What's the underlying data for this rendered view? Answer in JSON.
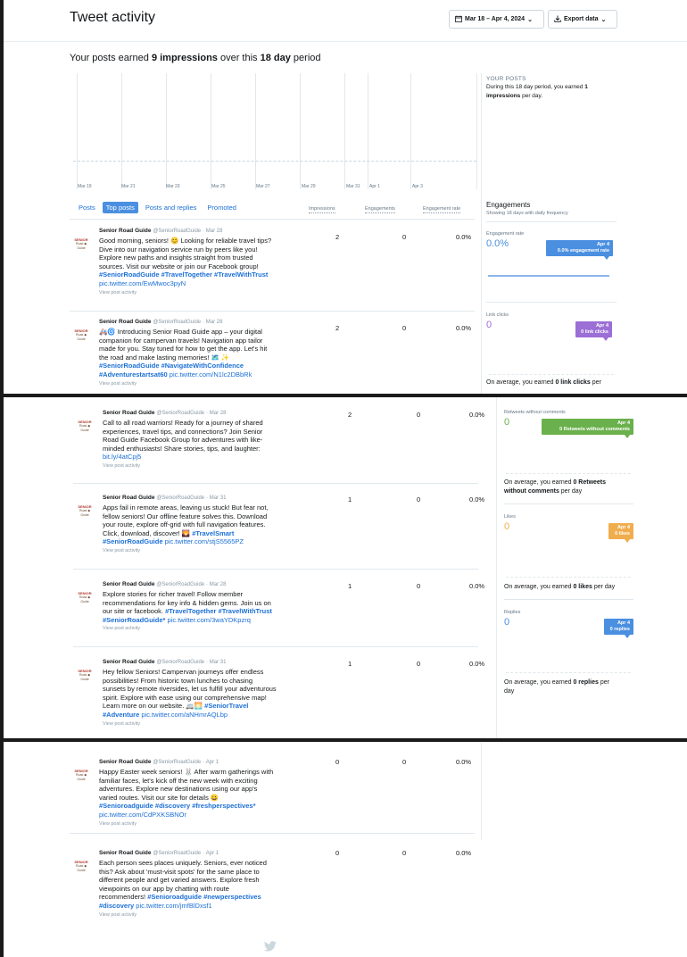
{
  "header": {
    "title": "Tweet activity",
    "date_range": "Mar 18 – Apr 4, 2024",
    "export_label": "Export data"
  },
  "summary": {
    "prefix": "Your posts earned ",
    "impressions": "9 impressions",
    "middle": " over this ",
    "period": "18 day",
    "suffix": " period"
  },
  "graph": {
    "x_labels": [
      "Mar 19",
      "Mar 21",
      "Mar 23",
      "Mar 25",
      "Mar 27",
      "Mar 29",
      "Mar 31",
      "Apr 1",
      "Apr 3"
    ]
  },
  "your_posts": {
    "heading": "YOUR POSTS",
    "text_a": "During this 18 day period, you earned ",
    "value": "1",
    "text_b": "impressions",
    "text_c": " per day."
  },
  "tabs": [
    "Posts",
    "Top posts",
    "Posts and replies",
    "Promoted"
  ],
  "columns": {
    "impressions": "Impressions",
    "engagements": "Engagements",
    "rate": "Engagement rate"
  },
  "author": {
    "name": "Senior Road Guide",
    "handle": "@SeniorRoadGuide",
    "avatar_l1": "SENIOR",
    "avatar_l2": "Road ◆ Guide"
  },
  "view_activity_label": "View post activity",
  "posts": [
    {
      "date": "Mar 28",
      "lines": [
        "Good morning, seniors! 😊 Looking for reliable travel tips?",
        "Dive into our navigation service run by peers like you!",
        "Explore new paths and insights straight from trusted",
        "sources. Visit our website or join our Facebook group!"
      ],
      "tags": "#SeniorRoadGuide #TravelTogether #TravelWithTrust",
      "link": "pic.twitter.com/EwMwoc3pyN",
      "impressions": "2",
      "engagements": "0",
      "rate": "0.0%"
    },
    {
      "date": "Mar 28",
      "lines": [
        "🚑🌀 Introducing Senior Road Guide app – your digital",
        "companion for campervan travels! Navigation app tailor",
        "made for you. Stay tuned for how to get the app. Let's hit",
        "the road and make lasting memories! 🗺️ ✨"
      ],
      "tags": "#SeniorRoadGuide #NavigateWithConfidence",
      "tags2": "#Adventurestartsat60",
      "link": "pic.twitter.com/N1lc2DBbRk",
      "impressions": "2",
      "engagements": "0",
      "rate": "0.0%"
    },
    {
      "date": "Mar 28",
      "lines": [
        "Call to all road warriors! Ready for a journey of shared",
        "experiences, travel tips, and connections? Join Senior",
        "Road Guide Facebook Group for adventures with like-",
        "minded enthusiasts! Share stories, tips, and laughter:"
      ],
      "link": "bit.ly/4atCpj5",
      "impressions": "2",
      "engagements": "0",
      "rate": "0.0%"
    },
    {
      "date": "Mar 31",
      "lines": [
        "Apps fail in remote areas, leaving us stuck! But fear not,",
        "fellow seniors! Our offline feature solves this. Download",
        "your route, explore off-grid with full navigation features.",
        "Click, download, discover! 🌄"
      ],
      "tags_inline": "#TravelSmart",
      "tags": "#SeniorRoadGuide",
      "link": "pic.twitter.com/stjS5565PZ",
      "impressions": "1",
      "engagements": "0",
      "rate": "0.0%"
    },
    {
      "date": "Mar 28",
      "lines": [
        "Explore stories for richer travel! Follow member",
        "recommendations for key info & hidden gems. Join us on",
        "our site or facebook."
      ],
      "tags_inline": "#TravelTogether #TravelWithTrust",
      "tags": "#SeniorRoadGuide*",
      "link": "pic.twitter.com/3waYDKpzrq",
      "impressions": "1",
      "engagements": "0",
      "rate": "0.0%"
    },
    {
      "date": "Mar 31",
      "lines": [
        "Hey fellow Seniors! Campervan journeys offer endless",
        "possibilities! From historic town lunches to chasing",
        "sunsets by remote riversides, let us fulfill your adventurous",
        "spirit. Explore with ease using our comprehensive map!",
        "Learn more on our website. 🚐🌅"
      ],
      "tags_inline": "#SeniorTravel",
      "tags": "#Adventure",
      "link": "pic.twitter.com/aNHmrAQLbp",
      "impressions": "1",
      "engagements": "0",
      "rate": "0.0%"
    },
    {
      "date": "Apr 1",
      "lines": [
        "Happy Easter week seniors! 🐰 After warm gatherings with",
        "familiar faces, let's kick off the new week with exciting",
        "adventures. Explore new destinations using our app's",
        "varied routes. Visit our site for details 😀"
      ],
      "tags": "#Senioroadguide #discovery #freshperspectives*",
      "link": "pic.twitter.com/CdPXKSBNOr",
      "impressions": "0",
      "engagements": "0",
      "rate": "0.0%"
    },
    {
      "date": "Apr 1",
      "lines": [
        "Each person sees places uniquely. Seniors, ever noticed",
        "this? Ask about 'must-visit spots' for the same place to",
        "different people and get varied answers. Explore fresh",
        "viewpoints on our app by chatting with route",
        "recommenders!"
      ],
      "tags_inline": "#Senioroadguide #newperspectives",
      "tags": "#discovery",
      "link": "pic.twitter.com/jmfBlDxsf1",
      "impressions": "0",
      "engagements": "0",
      "rate": "0.0%"
    }
  ],
  "engagements": {
    "heading": "Engagements",
    "sub": "Showing 18 days with daily frequency",
    "rate_label": "Engagement rate",
    "rate_value": "0.0%",
    "rate_flag_date": "Apr 4",
    "rate_flag_text": "0.0% engagement rate",
    "link_label": "Link clicks",
    "link_value": "0",
    "link_flag_date": "Apr 4",
    "link_flag_text": "0 link clicks",
    "link_avg_a": "On average, you earned ",
    "link_avg_b": "0 link clicks",
    "link_avg_c": " per",
    "rt_label": "Retweets without comments",
    "rt_value": "0",
    "rt_flag_date": "Apr 4",
    "rt_flag_text": "0 Retweets without comments",
    "rt_avg_a": "On average, you earned ",
    "rt_avg_b": "0 Retweets",
    "rt_avg_b2": "without comments",
    "rt_avg_c": " per day",
    "likes_label": "Likes",
    "likes_value": "0",
    "likes_flag_date": "Apr 4",
    "likes_flag_text": "0 likes",
    "likes_avg_a": "On average, you earned ",
    "likes_avg_b": "0 likes",
    "likes_avg_c": " per day",
    "replies_label": "Replies",
    "replies_value": "0",
    "replies_flag_date": "Apr 4",
    "replies_flag_text": "0 replies",
    "replies_avg_a": "On average, you earned ",
    "replies_avg_b": "0 replies",
    "replies_avg_c": " per",
    "replies_avg_d": "day"
  },
  "colors": {
    "blue": "#4a8fe0",
    "link": "#1b6fd6",
    "purple": "#9b6fd6",
    "green": "#6ab04c",
    "orange": "#f0ad4e",
    "replies": "#4a8fe0"
  }
}
